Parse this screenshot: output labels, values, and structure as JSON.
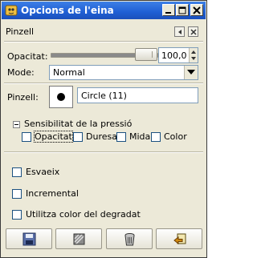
{
  "window": {
    "title": "Opcions de l'eina"
  },
  "dock": {
    "tab_label": "Pinzell"
  },
  "opacity": {
    "label": "Opacitat:",
    "value": "100,0",
    "level": 1.0
  },
  "mode": {
    "label": "Mode:",
    "selected": "Normal"
  },
  "brush": {
    "label": "Pinzell:",
    "name": "Circle (11)"
  },
  "pressure": {
    "label": "Sensibilitat de la pressió",
    "options": [
      {
        "label": "Opacitat",
        "checked": false
      },
      {
        "label": "Duresa",
        "checked": false
      },
      {
        "label": "Mida",
        "checked": false
      },
      {
        "label": "Color",
        "checked": false
      }
    ]
  },
  "options": [
    {
      "label": "Esvaeix",
      "checked": false
    },
    {
      "label": "Incremental",
      "checked": false
    },
    {
      "label": "Utilitza color del degradat",
      "checked": false
    }
  ],
  "toolbar": {
    "buttons": [
      {
        "icon": "save-icon"
      },
      {
        "icon": "restore-icon"
      },
      {
        "icon": "delete-icon"
      },
      {
        "icon": "reset-icon"
      }
    ]
  },
  "colors": {
    "titlebar": "#1f5fd4",
    "window_bg": "#ece9d8",
    "field_border": "#7f9db9"
  }
}
